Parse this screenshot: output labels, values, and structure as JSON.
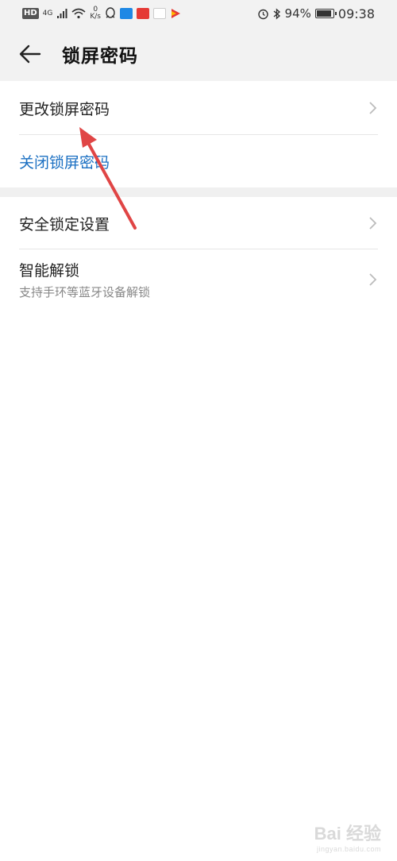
{
  "status_bar": {
    "hd": "HD",
    "network": "4G",
    "speed_value": "0",
    "speed_unit": "K/s",
    "battery_percent": "94%",
    "battery_level": 0.94,
    "time": "09:38"
  },
  "header": {
    "title": "锁屏密码"
  },
  "items": [
    {
      "label": "更改锁屏密码"
    },
    {
      "label": "关闭锁屏密码"
    },
    {
      "label": "安全锁定设置"
    },
    {
      "label": "智能解锁",
      "sublabel": "支持手环等蓝牙设备解锁"
    }
  ],
  "colors": {
    "accent_blue": "#1a6fc2",
    "annotation_arrow": "#e04545",
    "header_bg": "#f2f2f2"
  },
  "watermark": {
    "text": "Bai 经验",
    "sub": "jingyan.baidu.com"
  }
}
